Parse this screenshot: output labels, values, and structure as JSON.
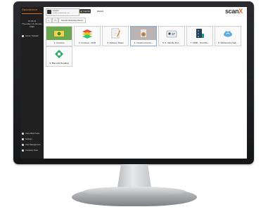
{
  "sidebar": {
    "logo": "Gasvaecom",
    "time": "16:33:21",
    "date": "Thursday, 16 January 2020",
    "items_top": [
      {
        "label": "Home / Uploads"
      }
    ],
    "items_bottom": [
      {
        "label": "Users Back Tools"
      },
      {
        "label": "Settings"
      },
      {
        "label": "User Management"
      },
      {
        "label": "Company Tools"
      }
    ]
  },
  "topbar": {
    "user_name": "scanbot",
    "user_email": "mail@scanbotcloud.com",
    "logout_label": "Log Out",
    "language": "DE/EN",
    "brand": "scan",
    "brand_mark": "X"
  },
  "nav": {
    "back": "←",
    "home": "⌂",
    "breadcrumb": "Scan2x Workshop Demo"
  },
  "tiles": [
    {
      "label": "1. Invoices",
      "icon": "money-icon"
    },
    {
      "label": "2. Invoices - ADR",
      "icon": "layers-icon"
    },
    {
      "label": "3. Delivery Notes",
      "icon": "notepad-icon"
    },
    {
      "label": "4. Invoice Line Ite...",
      "icon": "invoice-icon"
    },
    {
      "label": "5. 6. Identity Doc...",
      "icon": "id-card-icon"
    },
    {
      "label": "7. OMR - Test Ma...",
      "icon": "omr-icon"
    },
    {
      "label": "8. Webservice Vali...",
      "icon": "cloud-icon"
    },
    {
      "label": "9. Barcode Reading",
      "icon": "barcode-icon"
    }
  ]
}
